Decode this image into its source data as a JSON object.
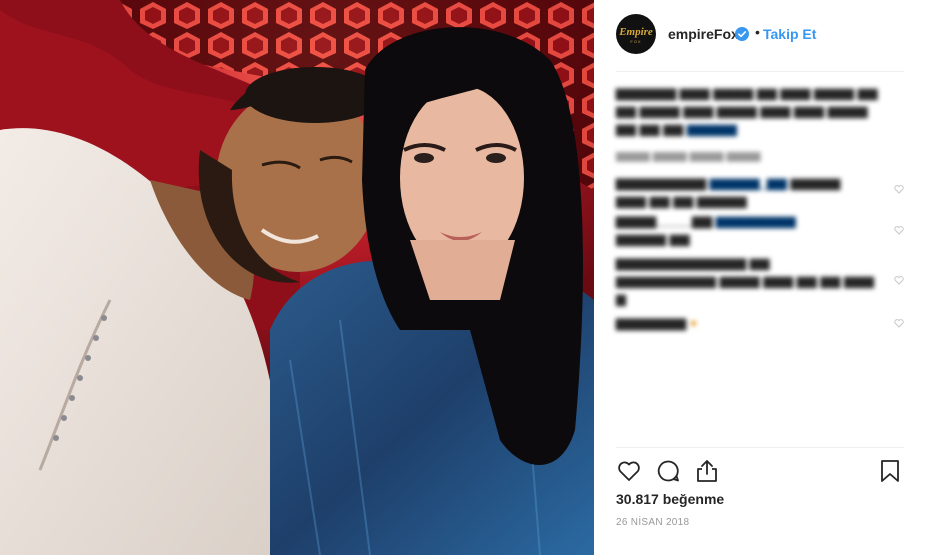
{
  "post": {
    "username": "empireFox",
    "avatar_logo": "Empire",
    "avatar_logo_sub": "FOX",
    "follow_separator": "•",
    "follow_label": "Takip Et",
    "likes_count": "30.817",
    "likes_label": "beğenme",
    "date": "26 NİSAN 2018"
  },
  "icons": {
    "verified": "verified-badge-icon",
    "like": "heart-outline-icon",
    "comment": "comment-bubble-icon",
    "share": "share-upload-icon",
    "save": "bookmark-outline-icon"
  },
  "colors": {
    "accent": "#3897f0",
    "text": "#262626",
    "muted": "#999999",
    "photo_background": "#7a1018"
  }
}
